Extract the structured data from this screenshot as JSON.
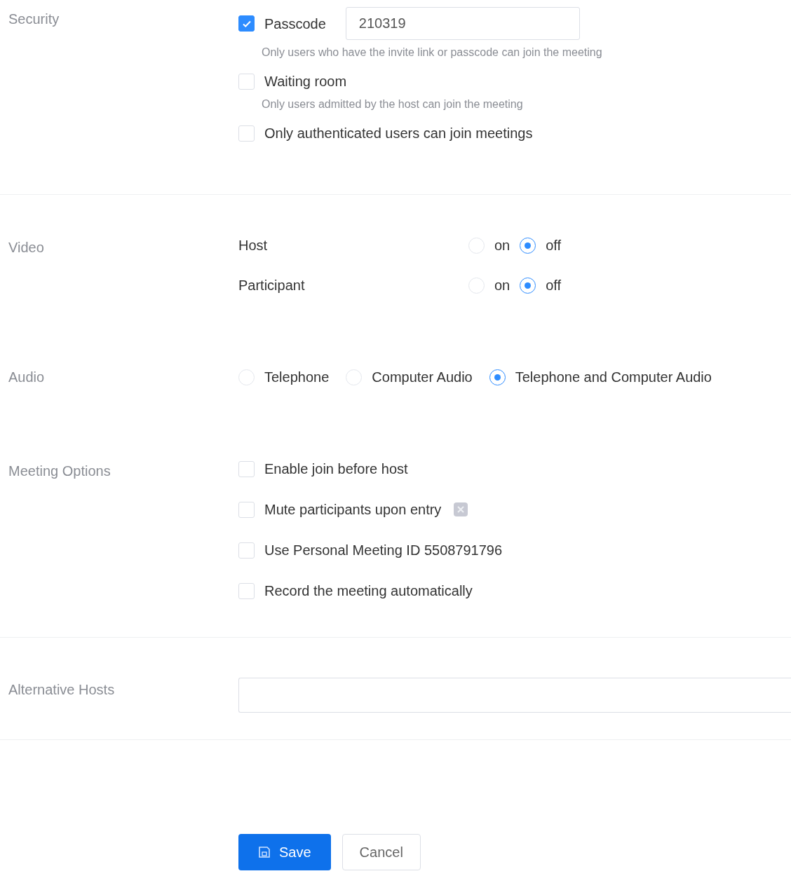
{
  "security": {
    "label": "Security",
    "options": [
      {
        "kind": "passcode",
        "label": "Passcode",
        "checked": true,
        "value": "210319",
        "hint": "Only users who have the invite link or passcode can join the meeting"
      },
      {
        "kind": "checkbox",
        "label": "Waiting room",
        "checked": false,
        "hint": "Only users admitted by the host can join the meeting"
      },
      {
        "kind": "checkbox",
        "label": "Only authenticated users can join meetings",
        "checked": false
      }
    ]
  },
  "video": {
    "label": "Video",
    "rows": [
      {
        "label": "Host",
        "choices": [
          {
            "label": "on",
            "selected": false
          },
          {
            "label": "off",
            "selected": true
          }
        ]
      },
      {
        "label": "Participant",
        "choices": [
          {
            "label": "on",
            "selected": false
          },
          {
            "label": "off",
            "selected": true
          }
        ]
      }
    ]
  },
  "audio": {
    "label": "Audio",
    "choices": [
      {
        "label": "Telephone",
        "selected": false
      },
      {
        "label": "Computer Audio",
        "selected": false
      },
      {
        "label": "Telephone and Computer Audio",
        "selected": true
      }
    ]
  },
  "meeting_options": {
    "label": "Meeting Options",
    "items": [
      {
        "label": "Enable join before host",
        "checked": false,
        "info_icon": false
      },
      {
        "label": "Mute participants upon entry",
        "checked": false,
        "info_icon": true
      },
      {
        "label": "Use Personal Meeting ID 5508791796",
        "checked": false,
        "info_icon": false
      },
      {
        "label": "Record the meeting automatically",
        "checked": false,
        "info_icon": false
      }
    ]
  },
  "alternative_hosts": {
    "label": "Alternative Hosts"
  },
  "buttons": [
    {
      "label": "Save",
      "kind": "primary"
    },
    {
      "label": "Cancel",
      "kind": "secondary"
    }
  ]
}
